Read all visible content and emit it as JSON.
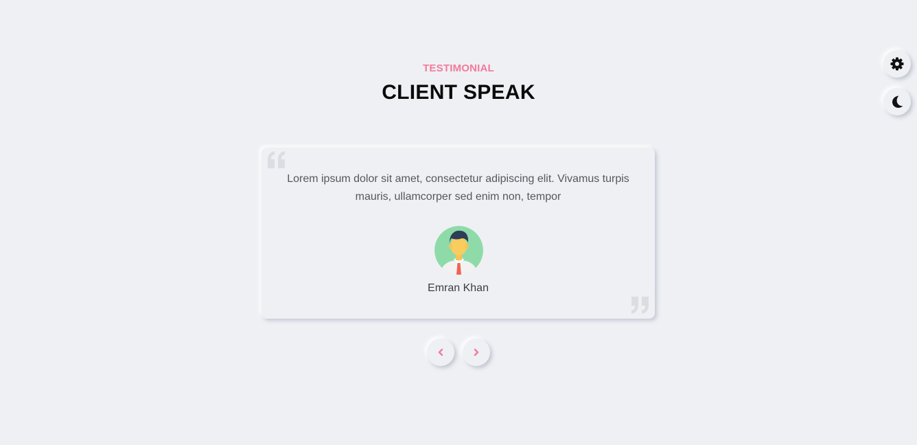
{
  "section": {
    "subtitle": "TESTIMONIAL",
    "title": "CLIENT SPEAK"
  },
  "testimonial": {
    "quote": "Lorem ipsum dolor sit amet, consectetur adipiscing elit. Vivamus turpis mauris, ullamcorper sed enim non, tempor",
    "client_name": "Emran Khan",
    "avatar_icon": "man-avatar-icon"
  },
  "carousel": {
    "prev_icon": "chevron-left-icon",
    "next_icon": "chevron-right-icon"
  },
  "side_controls": {
    "settings_icon": "gear-icon",
    "theme_icon": "moon-icon"
  },
  "colors": {
    "background": "#eff0f4",
    "accent": "#f27a9b",
    "title": "#0b0b0b",
    "text": "#55575c",
    "quote_mark": "#dcdde2"
  }
}
